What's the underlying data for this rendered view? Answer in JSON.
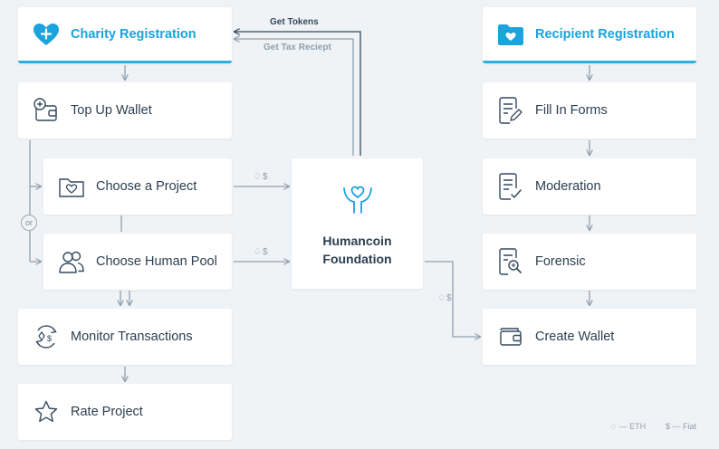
{
  "charity": {
    "header": "Charity Registration",
    "steps": {
      "top_up": "Top Up Wallet",
      "choose_project": "Choose a Project",
      "choose_pool": "Choose Human Pool",
      "monitor": "Monitor Transactions",
      "rate": "Rate Project"
    },
    "or_label": "or"
  },
  "foundation": {
    "name": "Humancoin Foundation"
  },
  "recipient": {
    "header": "Recipient Registration",
    "steps": {
      "forms": "Fill In Forms",
      "moderation": "Moderation",
      "forensic": "Forensic",
      "wallet": "Create Wallet"
    }
  },
  "flows": {
    "get_tokens": "Get Tokens",
    "get_tax_receipt": "Get Tax Reciept",
    "currency": "♢$"
  },
  "legend": {
    "eth": "♢ — ETH",
    "fiat": "$ — Fiat"
  },
  "colors": {
    "accent": "#1aa3dc",
    "text": "#2c3e50",
    "line": "#8fa0ae",
    "dark_line": "#34495e"
  }
}
